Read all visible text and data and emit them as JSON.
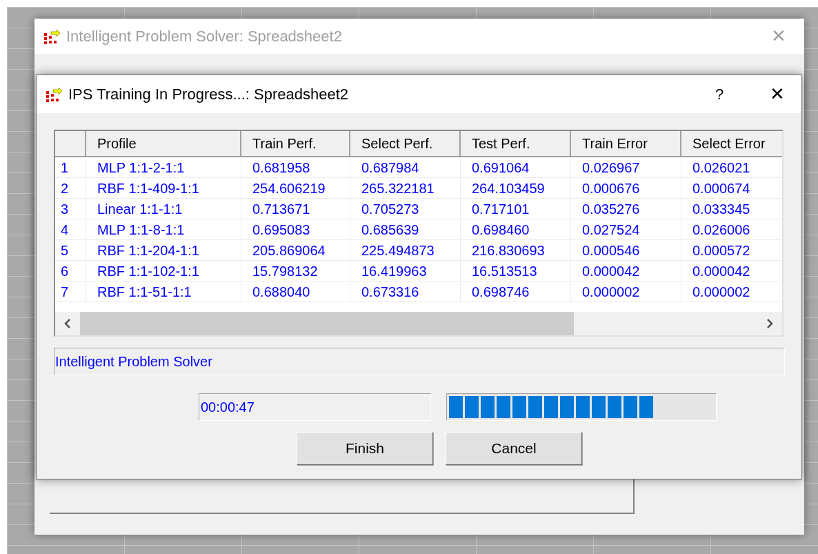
{
  "back_window": {
    "title": "Intelligent Problem Solver: Spreadsheet2",
    "close": "✕"
  },
  "dialog": {
    "title": "IPS Training In Progress...: Spreadsheet2",
    "help": "?",
    "close": "✕"
  },
  "table": {
    "columns": [
      "",
      "Profile",
      "Train Perf.",
      "Select Perf.",
      "Test Perf.",
      "Train Error",
      "Select Error"
    ],
    "rows": [
      [
        "1",
        "MLP 1:1-2-1:1",
        "0.681958",
        "0.687984",
        "0.691064",
        "0.026967",
        "0.026021"
      ],
      [
        "2",
        "RBF 1:1-409-1:1",
        "254.606219",
        "265.322181",
        "264.103459",
        "0.000676",
        "0.000674"
      ],
      [
        "3",
        "Linear 1:1-1:1",
        "0.713671",
        "0.705273",
        "0.717101",
        "0.035276",
        "0.033345"
      ],
      [
        "4",
        "MLP 1:1-8-1:1",
        "0.695083",
        "0.685639",
        "0.698460",
        "0.027524",
        "0.026006"
      ],
      [
        "5",
        "RBF 1:1-204-1:1",
        "205.869064",
        "225.494873",
        "216.830693",
        "0.000546",
        "0.000572"
      ],
      [
        "6",
        "RBF 1:1-102-1:1",
        "15.798132",
        "16.419963",
        "16.513513",
        "0.000042",
        "0.000042"
      ],
      [
        "7",
        "RBF 1:1-51-1:1",
        "0.688040",
        "0.673316",
        "0.698746",
        "0.000002",
        "0.000002"
      ]
    ]
  },
  "status": "Intelligent Problem Solver",
  "elapsed": "00:00:47",
  "progress": {
    "level": 0.78
  },
  "buttons": [
    "Finish",
    "Cancel"
  ]
}
